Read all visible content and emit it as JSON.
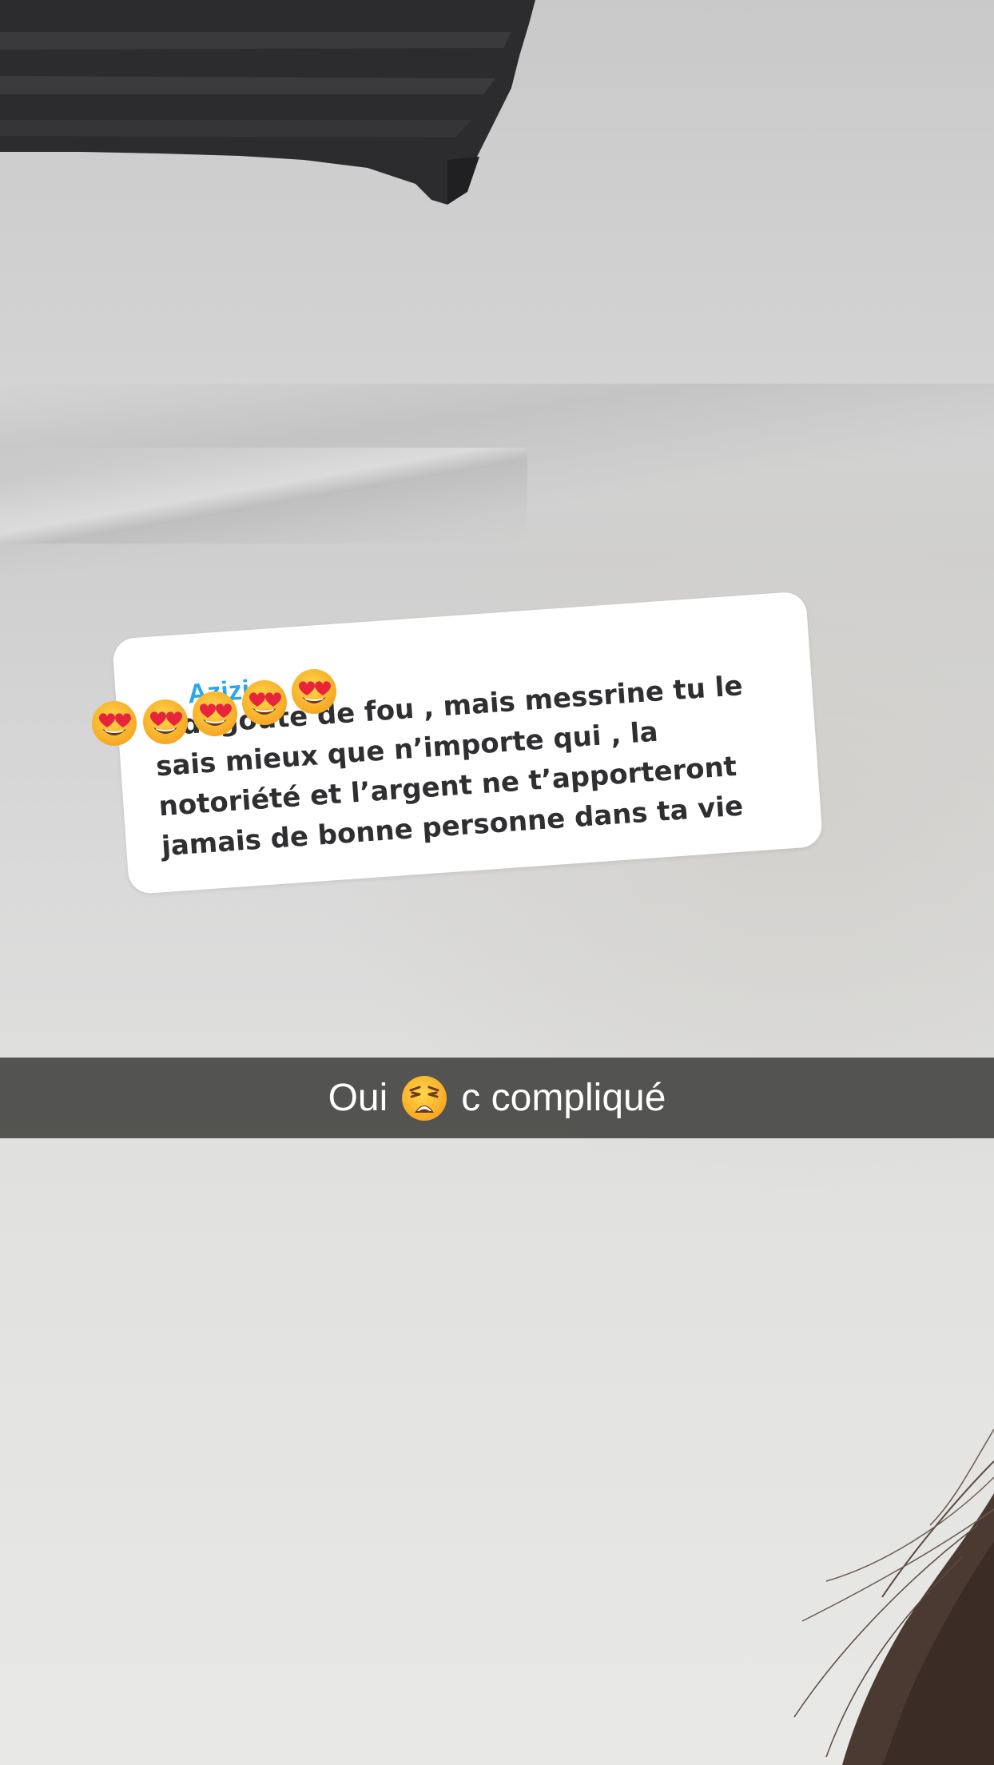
{
  "reply": {
    "author": "Azizie",
    "text": "il degoute de fou , mais messrine tu le sais mieux que n’importe qui , la notoriété et l’argent ne t’apporteront jamais de bonne personne dans ta vie",
    "emojis": [
      "heart-eyes-emoji",
      "heart-eyes-emoji",
      "heart-eyes-emoji",
      "heart-eyes-emoji",
      "heart-eyes-emoji"
    ]
  },
  "caption": {
    "before": "Oui",
    "emoji": "weary-face-emoji",
    "after": "c compliqué"
  },
  "colors": {
    "author_accent": "#2aa6ea",
    "reply_text": "#2f2f31",
    "caption_bar": "#4a4a48",
    "caption_text": "#ffffff"
  }
}
